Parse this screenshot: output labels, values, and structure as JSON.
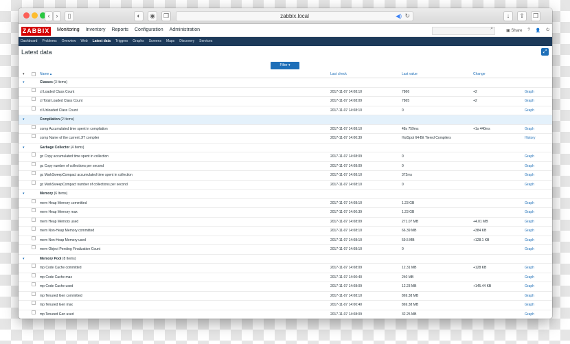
{
  "browser": {
    "url": "zabbix.local"
  },
  "header": {
    "logo": "ZABBIX",
    "menu": [
      "Monitoring",
      "Inventory",
      "Reports",
      "Configuration",
      "Administration"
    ],
    "share": "Share",
    "help": "?"
  },
  "subnav": [
    "Dashboard",
    "Problems",
    "Overview",
    "Web",
    "Latest data",
    "Triggers",
    "Graphs",
    "Screens",
    "Maps",
    "Discovery",
    "Services"
  ],
  "page": {
    "title": "Latest data",
    "filter_label": "Filter ▾"
  },
  "columns": {
    "name": "Name ▴",
    "last_check": "Last check",
    "last_value": "Last value",
    "change": "Change"
  },
  "rows": [
    {
      "type": "group",
      "name": "Classes",
      "count": "(3 Items)"
    },
    {
      "type": "item",
      "name": "cl Loaded Class Count",
      "check": "2017-11-07 14:08:10",
      "value": "7866",
      "change": "+2",
      "link": "Graph"
    },
    {
      "type": "item",
      "name": "cl Total Loaded Class Count",
      "check": "2017-11-07 14:08:09",
      "value": "7865",
      "change": "+2",
      "link": "Graph"
    },
    {
      "type": "item",
      "name": "cl Unloaded Class Count",
      "check": "2017-11-07 14:08:10",
      "value": "0",
      "change": "",
      "link": "Graph"
    },
    {
      "type": "group",
      "name": "Compilation",
      "count": "(2 Items)",
      "highlight": true
    },
    {
      "type": "item",
      "name": "comp Accumulated time spent in compilation",
      "check": "2017-11-07 14:08:10",
      "value": "48s 759ms",
      "change": "+1s 440ms",
      "link": "Graph"
    },
    {
      "type": "item",
      "name": "comp Name of the current JIT compiler",
      "check": "2017-11-07 14:00:39",
      "value": "HotSpot 64-Bit Tiered Compilers",
      "change": "",
      "link": "History"
    },
    {
      "type": "group",
      "name": "Garbage Collector",
      "count": "(4 Items)"
    },
    {
      "type": "item",
      "name": "gc Copy accumulated time spent in collection",
      "check": "2017-11-07 14:08:09",
      "value": "0",
      "change": "",
      "link": "Graph"
    },
    {
      "type": "item",
      "name": "gc Copy number of collections per second",
      "check": "2017-11-07 14:08:09",
      "value": "0",
      "change": "",
      "link": "Graph"
    },
    {
      "type": "item",
      "name": "gc MarkSweepCompact accumulated time spent in collection",
      "check": "2017-11-07 14:08:10",
      "value": "372ms",
      "change": "",
      "link": "Graph"
    },
    {
      "type": "item",
      "name": "gc MarkSweepCompact number of collections per second",
      "check": "2017-11-07 14:08:10",
      "value": "0",
      "change": "",
      "link": "Graph"
    },
    {
      "type": "group",
      "name": "Memory",
      "count": "(6 Items)"
    },
    {
      "type": "item",
      "name": "mem Heap Memory committed",
      "check": "2017-11-07 14:08:10",
      "value": "1.23 GB",
      "change": "",
      "link": "Graph"
    },
    {
      "type": "item",
      "name": "mem Heap Memory max",
      "check": "2017-11-07 14:00:39",
      "value": "1.23 GB",
      "change": "",
      "link": "Graph"
    },
    {
      "type": "item",
      "name": "mem Heap Memory used",
      "check": "2017-11-07 14:08:09",
      "value": "271.07 MB",
      "change": "+4.01 MB",
      "link": "Graph"
    },
    {
      "type": "item",
      "name": "mem Non-Heap Memory committed",
      "check": "2017-11-07 14:08:10",
      "value": "66.39 MB",
      "change": "+384 KB",
      "link": "Graph"
    },
    {
      "type": "item",
      "name": "mem Non-Heap Memory used",
      "check": "2017-11-07 14:08:10",
      "value": "59.5 MB",
      "change": "+128.1 KB",
      "link": "Graph"
    },
    {
      "type": "item",
      "name": "mem Object Pending Finalization Count",
      "check": "2017-11-07 14:08:10",
      "value": "0",
      "change": "",
      "link": "Graph"
    },
    {
      "type": "group",
      "name": "Memory Pool",
      "count": "(8 Items)"
    },
    {
      "type": "item",
      "name": "mp Code Cache committed",
      "check": "2017-11-07 14:08:09",
      "value": "12.31 MB",
      "change": "+128 KB",
      "link": "Graph"
    },
    {
      "type": "item",
      "name": "mp Code Cache max",
      "check": "2017-11-07 14:00:40",
      "value": "240 MB",
      "change": "",
      "link": "Graph"
    },
    {
      "type": "item",
      "name": "mp Code Cache used",
      "check": "2017-11-07 14:08:09",
      "value": "12.23 MB",
      "change": "+145.44 KB",
      "link": "Graph"
    },
    {
      "type": "item",
      "name": "mp Tenured Gen committed",
      "check": "2017-11-07 14:08:10",
      "value": "869.38 MB",
      "change": "",
      "link": "Graph"
    },
    {
      "type": "item",
      "name": "mp Tenured Gen max",
      "check": "2017-11-07 14:00:40",
      "value": "869.38 MB",
      "change": "",
      "link": "Graph"
    },
    {
      "type": "item",
      "name": "mp Tenured Gen used",
      "check": "2017-11-07 14:08:09",
      "value": "32.25 MB",
      "change": "",
      "link": "Graph"
    }
  ]
}
